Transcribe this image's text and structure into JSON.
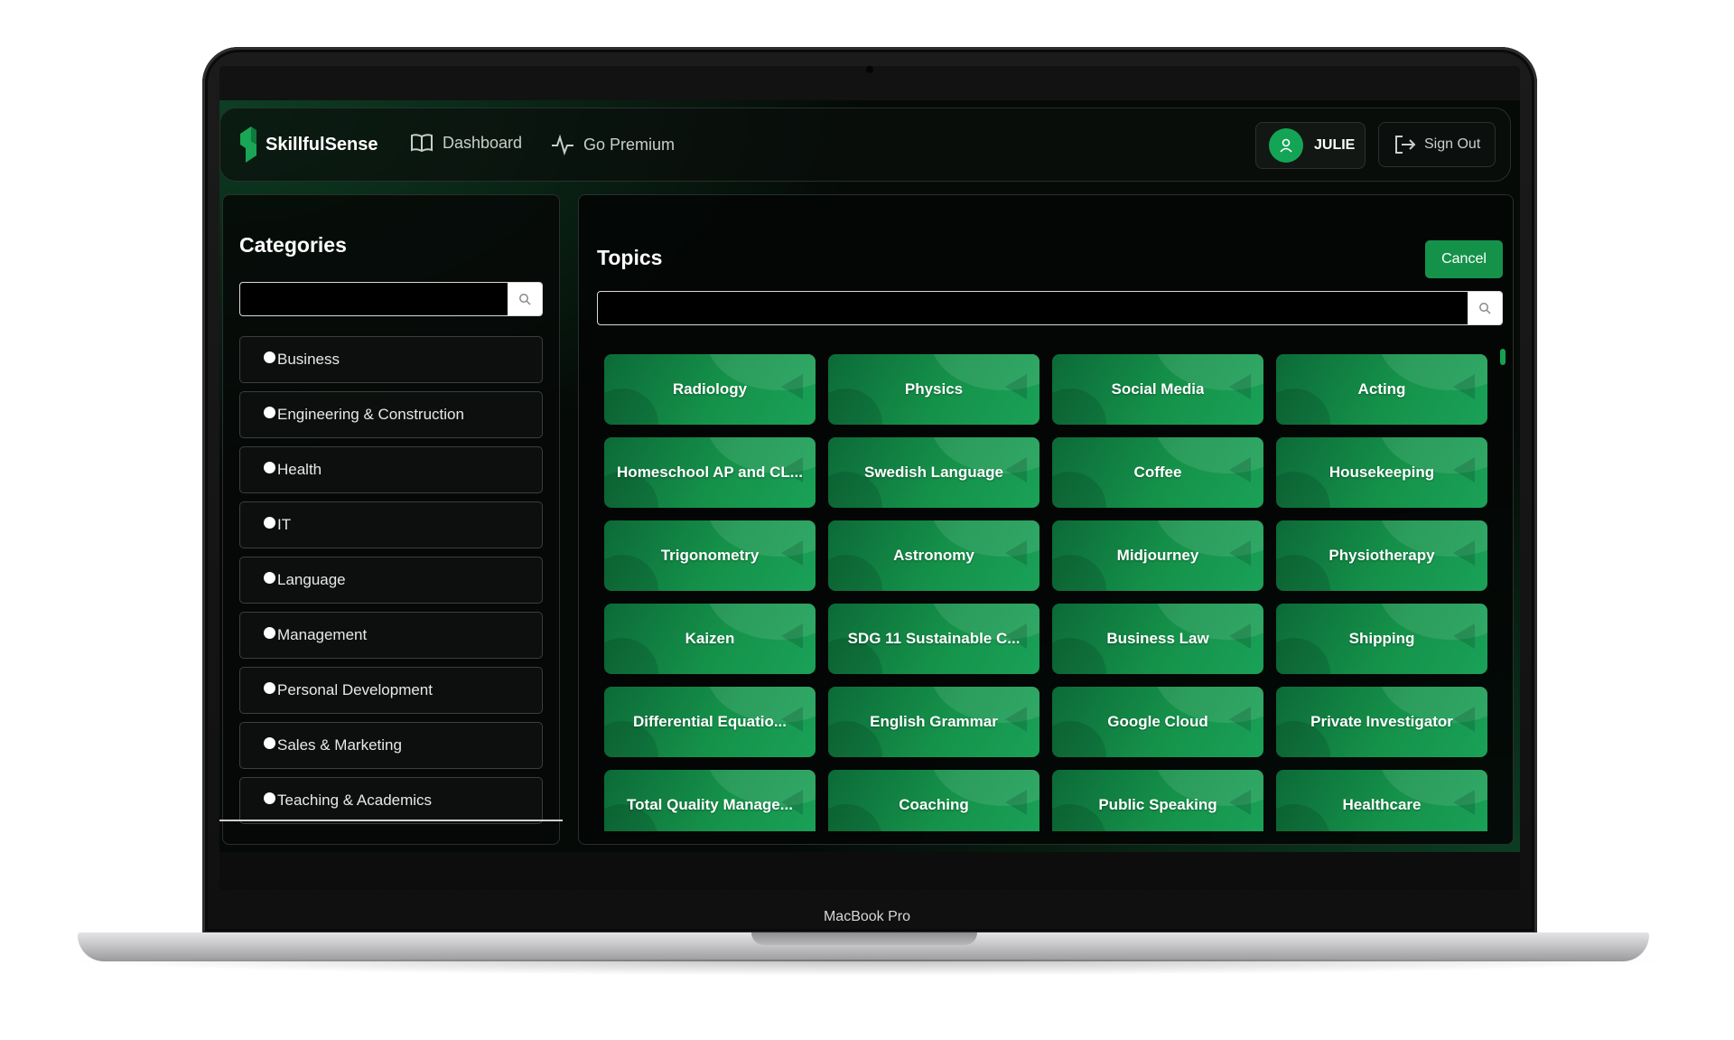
{
  "device": {
    "label": "MacBook Pro"
  },
  "header": {
    "brand": "SkillfulSense",
    "nav": [
      {
        "label": "Dashboard",
        "icon": "book-icon"
      },
      {
        "label": "Go Premium",
        "icon": "pulse-icon"
      }
    ],
    "user": {
      "name": "JULIE",
      "icon": "user-icon"
    },
    "sign_out": {
      "label": "Sign Out",
      "icon": "sign-out-icon"
    }
  },
  "categories": {
    "title": "Categories",
    "search": {
      "value": "",
      "placeholder": ""
    },
    "items": [
      "Business",
      "Engineering & Construction",
      "Health",
      "IT",
      "Language",
      "Management",
      "Personal Development",
      "Sales & Marketing",
      "Teaching & Academics"
    ]
  },
  "topics": {
    "title": "Topics",
    "cancel_label": "Cancel",
    "search": {
      "value": "",
      "placeholder": ""
    },
    "items": [
      "Radiology",
      "Physics",
      "Social Media",
      "Acting",
      "Homeschool AP and CL...",
      "Swedish Language",
      "Coffee",
      "Housekeeping",
      "Trigonometry",
      "Astronomy",
      "Midjourney",
      "Physiotherapy",
      "Kaizen",
      "SDG 11 Sustainable C...",
      "Business Law",
      "Shipping",
      "Differential Equatio...",
      "English Grammar",
      "Google Cloud",
      "Private Investigator",
      "Total Quality Manage...",
      "Coaching",
      "Public Speaking",
      "Healthcare"
    ]
  },
  "colors": {
    "accent": "#15924a",
    "tile_dark": "#0c6a38",
    "background": "#050a07"
  }
}
